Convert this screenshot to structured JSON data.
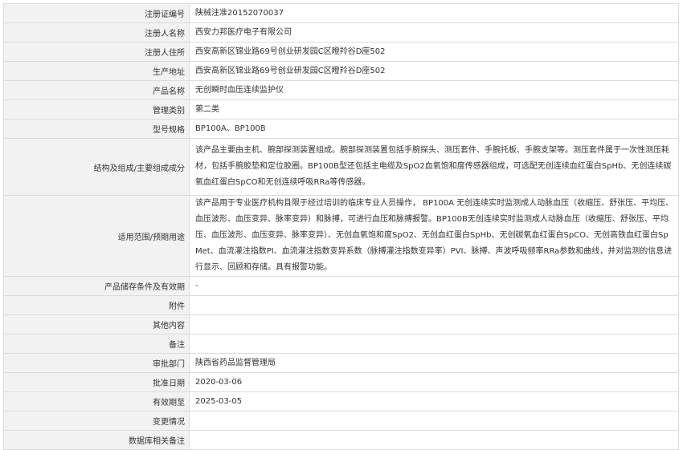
{
  "rows": [
    {
      "label": "注册证编号",
      "value": "陕械注准20152070037"
    },
    {
      "label": "注册人名称",
      "value": "西安力邦医疗电子有限公司"
    },
    {
      "label": "注册人住所",
      "value": "西安高新区锦业路69号创业研发园C区瞪羚谷D座502"
    },
    {
      "label": "生产地址",
      "value": "西安高新区锦业路69号创业研发园C区瞪羚谷D座502"
    },
    {
      "label": "产品名称",
      "value": "无创瞬时血压连续监护仪"
    },
    {
      "label": "管理类别",
      "value": "第二类"
    },
    {
      "label": "型号规格",
      "value": "BP100A、BP100B"
    },
    {
      "label": "结构及组成/主要组成成分",
      "value": "该产品主要由主机、腕部探测装置组成。腕部探测装置包括手腕探头、测压套件、手腕托板、手腕支架等。测压套件属于一次性测压耗材，包括手腕胶垫和定位胶圈。BP100B型还包括主电缆及SpO2血氧饱和度传感器组成，可选配无创连续血红蛋白SpHb、无创连续碳氧血红蛋白SpCO和无创连续呼吸RRa等传感器。"
    },
    {
      "label": "适用范围/预期用途",
      "value": "该产品用于专业医疗机构且限于经过培训的临床专业人员操作， BP100A 无创连续实时监测成人动脉血压（收缩压、舒张压、平均压、血压波形、血压变异、脉率变异）和脉搏，可进行血压和脉搏报警。BP100B无创连续实时监测成人动脉血压（收缩压、舒张压、平均压、血压波形、血压变异、脉率变异）、无创血氧饱和度SpO2、无创血红蛋白SpHb、无创碳氧血红蛋白SpCO、无创高铁血红蛋白SpMet、血流灌注指数PI、血流灌注指数变异系数（脉搏灌注指数变异率）PVI、脉搏、声波呼吸频率RRa参数和曲线，并对监测的信息进行显示、回顾和存储。具有报警功能。"
    },
    {
      "label": "产品储存条件及有效期",
      "value": "-"
    },
    {
      "label": "附件",
      "value": ""
    },
    {
      "label": "其他内容",
      "value": ""
    },
    {
      "label": "备注",
      "value": ""
    },
    {
      "label": "审批部门",
      "value": "陕西省药品监督管理局"
    },
    {
      "label": "批准日期",
      "value": "2020-03-06"
    },
    {
      "label": "有效期至",
      "value": "2025-03-05"
    },
    {
      "label": "变更情况",
      "value": ""
    },
    {
      "label": "数据库相关备注",
      "value": ""
    }
  ]
}
